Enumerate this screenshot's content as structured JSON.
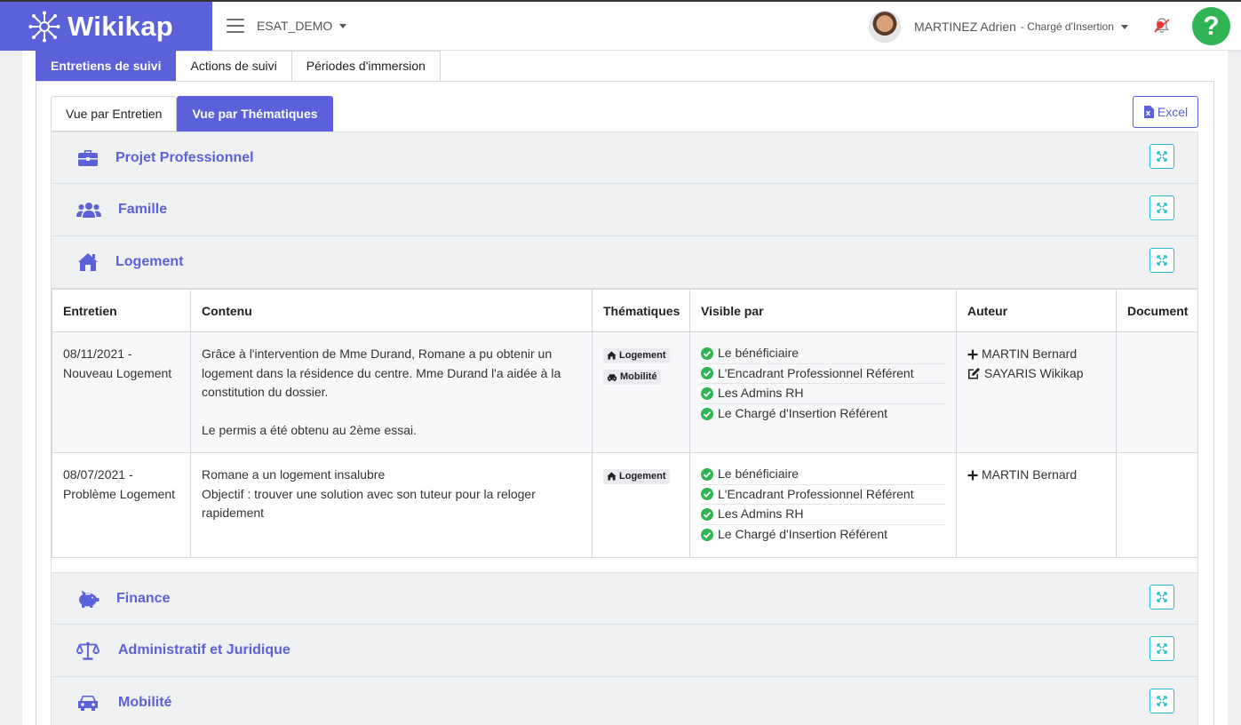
{
  "app": {
    "brand": "Wikikap",
    "organization": "ESAT_DEMO",
    "user_name": "MARTINEZ Adrien",
    "user_role": "- Chargé d'Insertion",
    "help_label": "?"
  },
  "colors": {
    "brand": "#5b61d9",
    "check_green": "#2fb553",
    "expand_cyan": "#2bbbd6"
  },
  "main_tabs": [
    {
      "label": "Entretiens de suivi",
      "active": true
    },
    {
      "label": "Actions de suivi",
      "active": false
    },
    {
      "label": "Périodes d'immersion",
      "active": false
    }
  ],
  "sub_tabs": [
    {
      "label": "Vue par Entretien",
      "active": false
    },
    {
      "label": "Vue par Thématiques",
      "active": true
    }
  ],
  "excel_label": "Excel",
  "sections": [
    {
      "title": "Projet Professionnel",
      "icon": "briefcase-icon",
      "expanded": false
    },
    {
      "title": "Famille",
      "icon": "users-icon",
      "expanded": false
    },
    {
      "title": "Logement",
      "icon": "home-icon",
      "expanded": true
    },
    {
      "title": "Finance",
      "icon": "piggy-bank-icon",
      "expanded": false
    },
    {
      "title": "Administratif et Juridique",
      "icon": "balance-scale-icon",
      "expanded": false
    },
    {
      "title": "Mobilité",
      "icon": "car-icon",
      "expanded": false
    }
  ],
  "table": {
    "headers": [
      "Entretien",
      "Contenu",
      "Thématiques",
      "Visible par",
      "Auteur",
      "Document"
    ],
    "rows": [
      {
        "entretien_date": "08/11/2021 -",
        "entretien_title": "Nouveau Logement",
        "contenu_p1": "Grâce à l'intervention de Mme Durand, Romane a pu obtenir un logement dans la résidence du centre. Mme Durand l'a aidée à la constitution du dossier.",
        "contenu_p2": "Le permis a été obtenu au 2ème essai.",
        "themes": [
          "Logement",
          "Mobilité"
        ],
        "visible_par": [
          "Le bénéficiaire",
          "L'Encadrant Professionnel Référent",
          "Les Admins RH",
          "Le Chargé d'Insertion Référent"
        ],
        "auteur_created": "MARTIN Bernard",
        "auteur_edited": "SAYARIS Wikikap",
        "document": ""
      },
      {
        "entretien_date": "08/07/2021 -",
        "entretien_title": "Problème Logement",
        "contenu_p1": "Romane a un logement insalubre",
        "contenu_p2": "Objectif : trouver une solution avec son tuteur pour la reloger rapidement",
        "themes": [
          "Logement"
        ],
        "visible_par": [
          "Le bénéficiaire",
          "L'Encadrant Professionnel Référent",
          "Les Admins RH",
          "Le Chargé d'Insertion Référent"
        ],
        "auteur_created": "MARTIN Bernard",
        "document": ""
      }
    ]
  }
}
